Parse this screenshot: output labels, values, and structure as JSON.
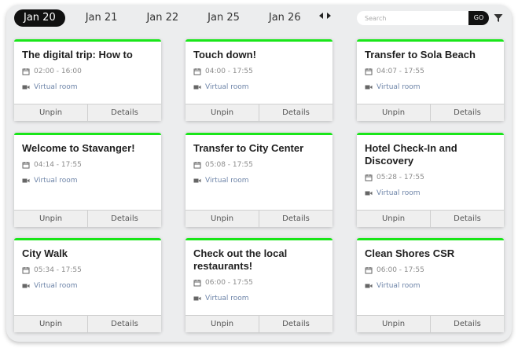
{
  "header": {
    "dates": [
      "Jan 20",
      "Jan 21",
      "Jan 22",
      "Jan 25",
      "Jan 26"
    ],
    "active_date": "Jan 20",
    "search_placeholder": "Search",
    "go_label": "GO"
  },
  "colors": {
    "accent": "#19e619",
    "active_tab_bg": "#111111",
    "room_link": "#6d84a8"
  },
  "cards": [
    {
      "title": "The digital trip: How to",
      "time": "02:00 - 16:00",
      "room": "Virtual room",
      "unpin": "Unpin",
      "details": "Details"
    },
    {
      "title": "Touch down!",
      "time": "04:00 - 17:55",
      "room": "Virtual room",
      "unpin": "Unpin",
      "details": "Details"
    },
    {
      "title": "Transfer to Sola Beach",
      "time": "04:07 - 17:55",
      "room": "Virtual room",
      "unpin": "Unpin",
      "details": "Details"
    },
    {
      "title": "Welcome to Stavanger!",
      "time": "04:14 - 17:55",
      "room": "Virtual room",
      "unpin": "Unpin",
      "details": "Details"
    },
    {
      "title": "Transfer to City Center",
      "time": "05:08 - 17:55",
      "room": "Virtual room",
      "unpin": "Unpin",
      "details": "Details"
    },
    {
      "title": "Hotel Check-In and Discovery",
      "time": "05:28 - 17:55",
      "room": "Virtual room",
      "unpin": "Unpin",
      "details": "Details"
    },
    {
      "title": "City Walk",
      "time": "05:34 - 17:55",
      "room": "Virtual room",
      "unpin": "Unpin",
      "details": "Details"
    },
    {
      "title": "Check out the local restaurants!",
      "time": "06:00 - 17:55",
      "room": "Virtual room",
      "unpin": "Unpin",
      "details": "Details"
    },
    {
      "title": "Clean Shores CSR",
      "time": "06:00 - 17:55",
      "room": "Virtual room",
      "unpin": "Unpin",
      "details": "Details"
    }
  ]
}
